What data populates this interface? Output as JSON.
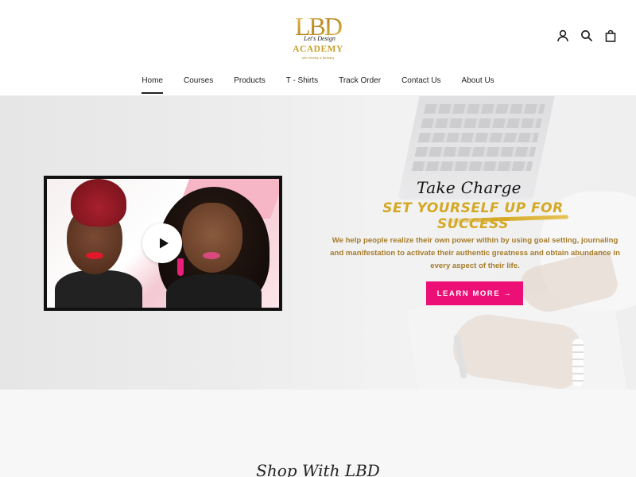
{
  "brand": {
    "logo_initials": "LBD",
    "logo_script": "Let's Design",
    "logo_main": "ACADEMY",
    "logo_sub": "with Wesley & Bethany",
    "colors": {
      "gold": "#c7a02c",
      "pink": "#ec0f76",
      "body_text": "#a67c2a"
    }
  },
  "header_icons": [
    {
      "name": "account-icon"
    },
    {
      "name": "search-icon"
    },
    {
      "name": "cart-icon"
    }
  ],
  "nav": {
    "items": [
      {
        "label": "Home",
        "active": true
      },
      {
        "label": "Courses",
        "active": false
      },
      {
        "label": "Products",
        "active": false
      },
      {
        "label": "T - Shirts",
        "active": false
      },
      {
        "label": "Track Order",
        "active": false
      },
      {
        "label": "Contact Us",
        "active": false
      },
      {
        "label": "About Us",
        "active": false
      }
    ]
  },
  "hero": {
    "title_line1": "Take Charge",
    "title_line2": "Set yourself up for success",
    "body": "We help people realize their own power within by using goal setting, journaling and manifestation to activate their authentic greatness and obtain abundance in every aspect of their life.",
    "cta_label": "LEARN MORE →",
    "video": {
      "play_icon": "play-icon"
    }
  },
  "lower": {
    "section_title": "Shop With LBD"
  }
}
